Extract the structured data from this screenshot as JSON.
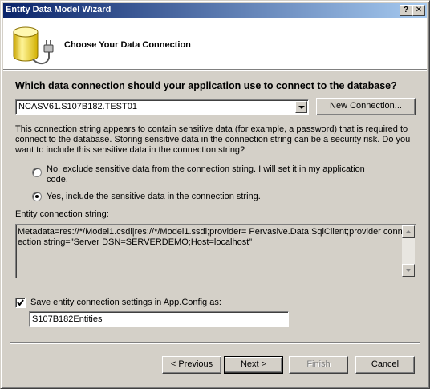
{
  "window": {
    "title": "Entity Data Model Wizard",
    "help_btn": "?",
    "close_btn": "✕"
  },
  "header": {
    "title": "Choose Your Data Connection",
    "icon": "database-plug-icon"
  },
  "connection": {
    "question": "Which data connection should your application use to connect to the database?",
    "selected": "NCASV61.S107B182.TEST01",
    "new_connection_label": "New Connection..."
  },
  "sensitive": {
    "description": "This connection string appears to contain sensitive data (for example, a password) that is required to connect to the database. Storing sensitive data in the connection string can be a security risk. Do you want to include this sensitive data in the connection string?",
    "option_no": "No, exclude sensitive data from the connection string. I will set it in my application code.",
    "option_yes": "Yes, include the sensitive data in the connection string.",
    "selected": "yes"
  },
  "entity_string": {
    "label": "Entity connection string:",
    "value": "Metadata=res://*/Model1.csdl|res://*/Model1.ssdl;provider= Pervasive.Data.SqlClient;provider connection string=\"Server DSN=SERVERDEMO;Host=localhost\""
  },
  "save": {
    "checked": true,
    "label": "Save entity connection settings in App.Config as:",
    "value": "S107B182Entities"
  },
  "buttons": {
    "previous": "< Previous",
    "next": "Next >",
    "finish": "Finish",
    "cancel": "Cancel"
  },
  "colors": {
    "title_gradient_start": "#0a246a",
    "title_gradient_end": "#a6caf0",
    "face": "#d4d0c8"
  }
}
